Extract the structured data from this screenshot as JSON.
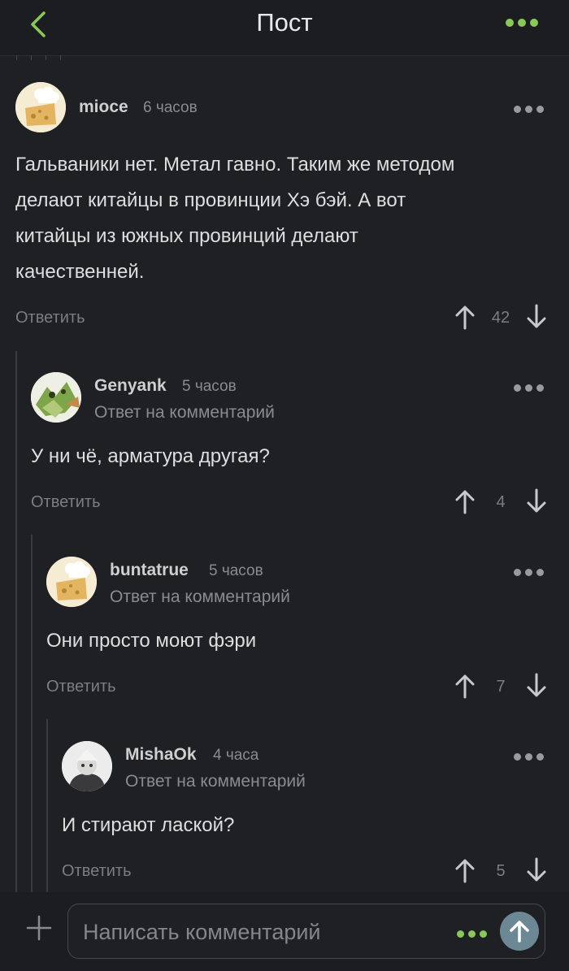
{
  "header": {
    "title": "Пост"
  },
  "comments": [
    {
      "user": "mioce",
      "time": "6 часов",
      "reply_to": "",
      "text": "Гальваники нет. Метал гавно. Таким же методом делают китайцы в провинции Хэ бэй. А вот китайцы из южных провинций делают качественней.",
      "lines": [
        "Гальваники нет. Метал гавно. Таким же методом",
        "делают китайцы в провинции Хэ бэй. А вот",
        "китайцы из южных провинций делают",
        "качественней."
      ],
      "reply_label": "Ответить",
      "score": "42",
      "avatar": "chef-cheese-avatar"
    },
    {
      "user": "Genyank",
      "time": "5 часов",
      "reply_to": "Ответ на комментарий",
      "lines": [
        "У ни чё, арматура другая?"
      ],
      "reply_label": "Ответить",
      "score": "4",
      "avatar": "frog-sticker-avatar"
    },
    {
      "user": "buntatrue",
      "time": "5 часов",
      "reply_to": "Ответ на комментарий",
      "lines": [
        "Они просто моют фэри"
      ],
      "reply_label": "Ответить",
      "score": "7",
      "avatar": "chef-cheese-avatar"
    },
    {
      "user": "MishaOk",
      "time": "4 часа",
      "reply_to": "Ответ на комментарий",
      "lines": [
        "И стирают лаской?"
      ],
      "reply_label": "Ответить",
      "score": "5",
      "avatar": "person-photo-avatar"
    }
  ],
  "composer": {
    "placeholder": "Написать комментарий"
  },
  "colors": {
    "accent": "#8ac858",
    "background": "#1f2023",
    "send": "#6c8895"
  }
}
